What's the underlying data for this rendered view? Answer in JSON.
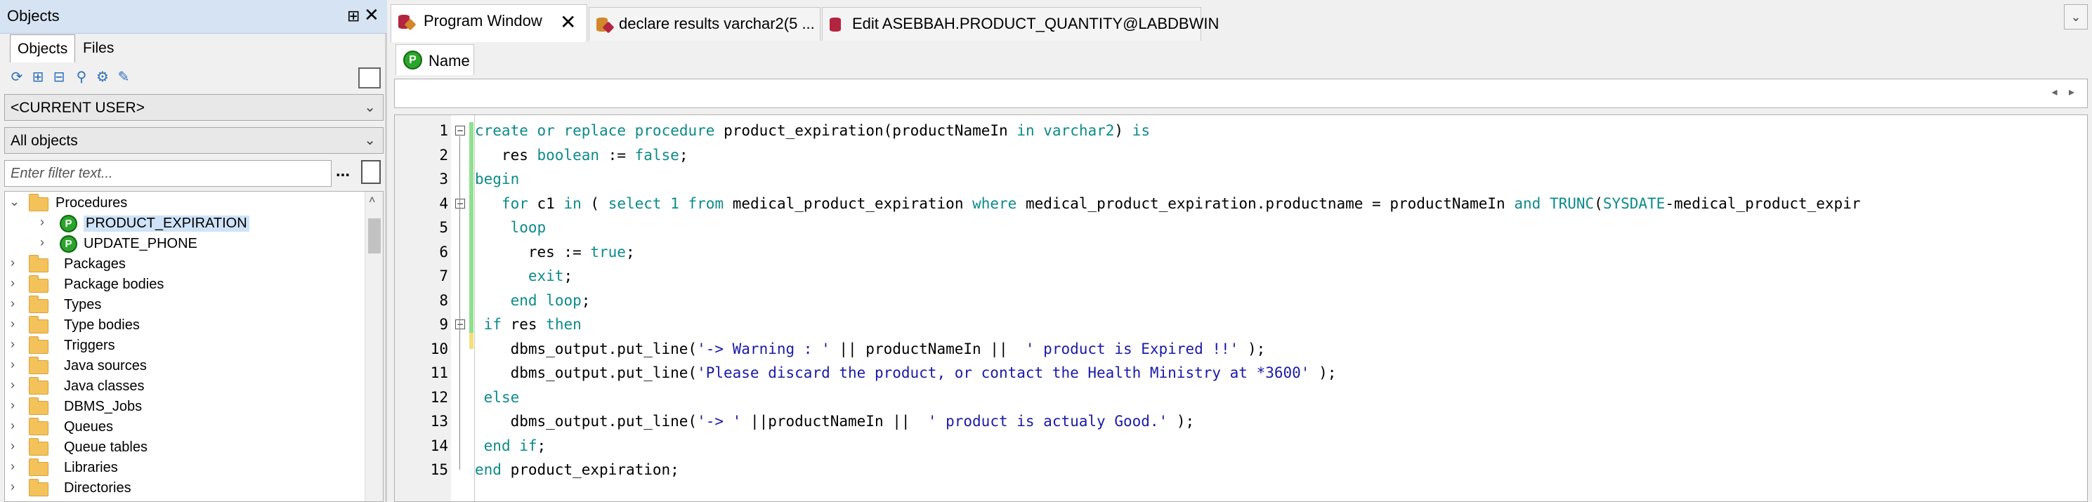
{
  "objects_panel": {
    "title": "Objects",
    "pin_glyph": "⊞",
    "close_glyph": "✕",
    "tabs": [
      "Objects",
      "Files"
    ],
    "user_dropdown": "<CURRENT USER>",
    "filter_dropdown": "All objects",
    "filter_placeholder": "Enter filter text...",
    "filter_more": "...",
    "tree": {
      "procedures_folder": "Procedures",
      "procedures": [
        "PRODUCT_EXPIRATION",
        "UPDATE_PHONE"
      ],
      "proc_icon_letter": "P",
      "folders": [
        "Packages",
        "Package bodies",
        "Types",
        "Type bodies",
        "Triggers",
        "Java sources",
        "Java classes",
        "DBMS_Jobs",
        "Queues",
        "Queue tables",
        "Libraries",
        "Directories"
      ]
    }
  },
  "doc_tabs": [
    {
      "label": "Program Window",
      "active": true,
      "close": "✕"
    },
    {
      "label": "declare results varchar2(5 ..."
    },
    {
      "label": "Edit ASEBBAH.PRODUCT_QUANTITY@LABDBWIN"
    }
  ],
  "tabs_menu_glyph": "⌄",
  "name_tab": {
    "label": "Name",
    "icon_letter": "P"
  },
  "strip_nav": "◂ ▸",
  "editor": {
    "lines": [
      {
        "n": "1",
        "code": "create or replace procedure product_expiration(productNameIn in varchar2) is"
      },
      {
        "n": "2",
        "code": "   res boolean := false;"
      },
      {
        "n": "3",
        "code": "begin"
      },
      {
        "n": "4",
        "code": "   for c1 in ( select 1 from medical_product_expiration where medical_product_expiration.productname = productNameIn and TRUNC(SYSDATE-medical_product_expir"
      },
      {
        "n": "5",
        "code": "    loop"
      },
      {
        "n": "6",
        "code": "      res := true;"
      },
      {
        "n": "7",
        "code": "      exit;"
      },
      {
        "n": "8",
        "code": "    end loop;"
      },
      {
        "n": "9",
        "code": " if res then"
      },
      {
        "n": "10",
        "code": "    dbms_output.put_line('-> Warning : ' || productNameIn ||  ' product is Expired !!' );"
      },
      {
        "n": "11",
        "code": "    dbms_output.put_line('Please discard the product, or contact the Health Ministry at *3600' );"
      },
      {
        "n": "12",
        "code": " else"
      },
      {
        "n": "13",
        "code": "    dbms_output.put_line('-> ' ||productNameIn ||  ' product is actualy Good.' );"
      },
      {
        "n": "14",
        "code": " end if;"
      },
      {
        "n": "15",
        "code": "end product_expiration;"
      }
    ]
  },
  "colors": {
    "keyword": "#0d8a8a",
    "string": "#1a1aa6",
    "title_bar": "#d6e3f3",
    "selected_row": "#cfe3f8"
  }
}
